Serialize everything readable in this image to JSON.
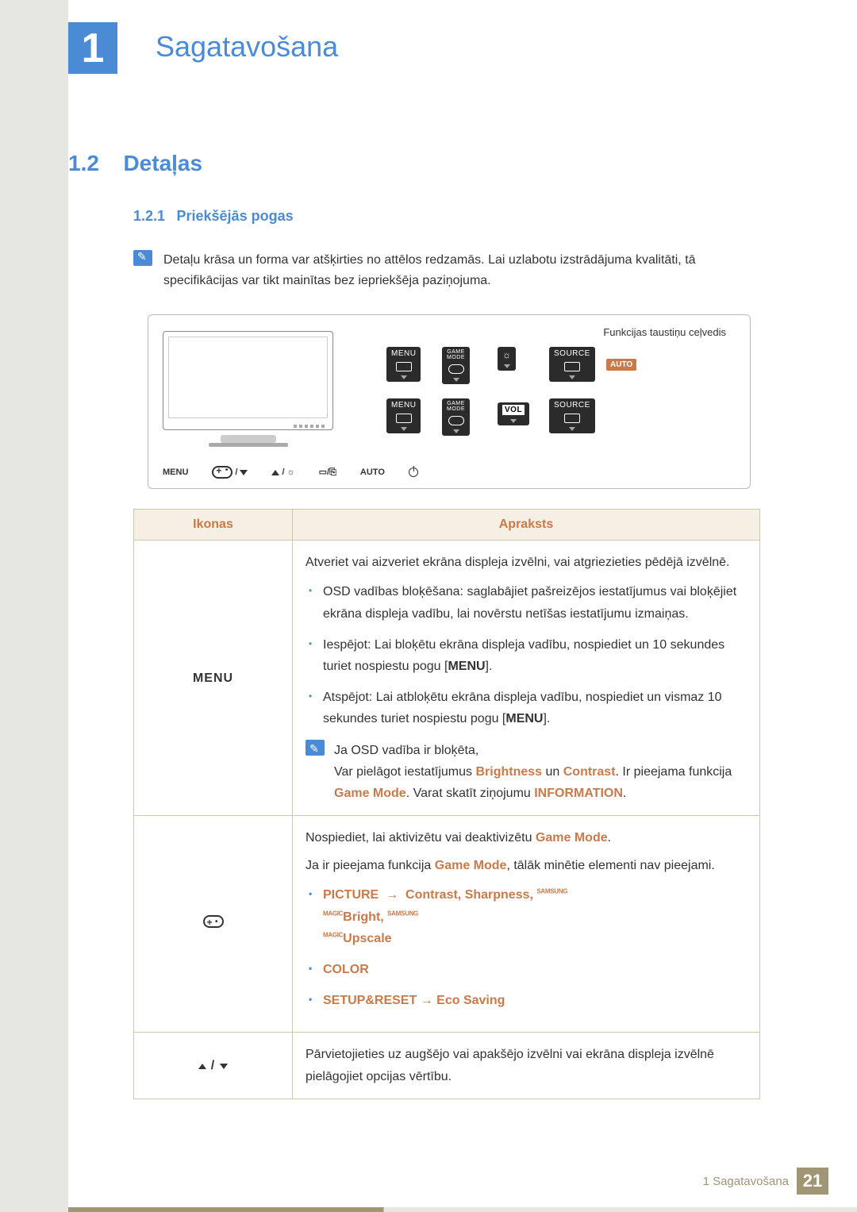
{
  "chapter": {
    "number": "1",
    "title": "Sagatavošana"
  },
  "section": {
    "number": "1.2",
    "title": "Detaļas"
  },
  "subsection": {
    "number": "1.2.1",
    "title": "Priekšējās pogas"
  },
  "note": "Detaļu krāsa un forma var atšķirties no attēlos redzamās. Lai uzlabotu izstrādājuma kvalitāti, tā specifikācijas var tikt mainītas bez iepriekšēja paziņojuma.",
  "diagram": {
    "guide_title": "Funkcijas taustiņu ceļvedis",
    "labels": {
      "menu": "MENU",
      "game": "GAME\nMODE",
      "source": "SOURCE",
      "auto": "AUTO",
      "vol": "VOL"
    },
    "strip": {
      "menu": "MENU",
      "auto": "AUTO"
    }
  },
  "table": {
    "headers": {
      "icons": "Ikonas",
      "desc": "Apraksts"
    },
    "row1": {
      "icon": "MENU",
      "p1": "Atveriet vai aizveriet ekrāna displeja izvēlni, vai atgriezieties pēdējā izvēlnē.",
      "b1": "OSD vadības bloķēšana: saglabājiet pašreizējos iestatījumus vai bloķējiet ekrāna displeja vadību, lai novērstu netīšas iestatījumu izmaiņas.",
      "b2a": "Iespējot: Lai bloķētu ekrāna displeja vadību, nospiediet un 10 sekundes turiet nospiestu pogu [",
      "b2b": "].",
      "b3a": "Atspējot: Lai atbloķētu ekrāna displeja vadību, nospiediet un vismaz 10 sekundes turiet nospiestu pogu [",
      "b3b": "].",
      "n1": "Ja OSD vadība ir bloķēta,",
      "n2a": "Var pielāgot iestatījumus ",
      "n2b": " un ",
      "n2c": ". Ir pieejama funkcija ",
      "n2d": ". Varat skatīt ziņojumu ",
      "n2e": ".",
      "hl": {
        "brightness": "Brightness",
        "contrast": "Contrast",
        "game_mode": "Game Mode",
        "information": "INFORMATION",
        "menu_btn": "MENU"
      }
    },
    "row2": {
      "p1a": "Nospiediet, lai aktivizētu vai deaktivizētu ",
      "p1b": ".",
      "p2a": "Ja ir pieejama funkcija ",
      "p2b": ", tālāk minētie elementi nav pieejami.",
      "b1_pre": "PICTURE",
      "b1_arrow": "→",
      "b1_items": "Contrast, Sharpness, ",
      "b1_bright": "Bright, ",
      "b1_upscale": "Upscale",
      "b2": "COLOR",
      "b3_pre": "SETUP&RESET",
      "b3_arrow": "→",
      "b3_item": "Eco Saving",
      "hl": {
        "game_mode": "Game Mode",
        "magic": "SAMSUNG\nMAGIC"
      }
    },
    "row3": {
      "p1": "Pārvietojieties uz augšējo vai apakšējo izvēlni vai ekrāna displeja izvēlnē pielāgojiet opcijas vērtību."
    }
  },
  "footer": {
    "label": "1 Sagatavošana",
    "page": "21"
  }
}
